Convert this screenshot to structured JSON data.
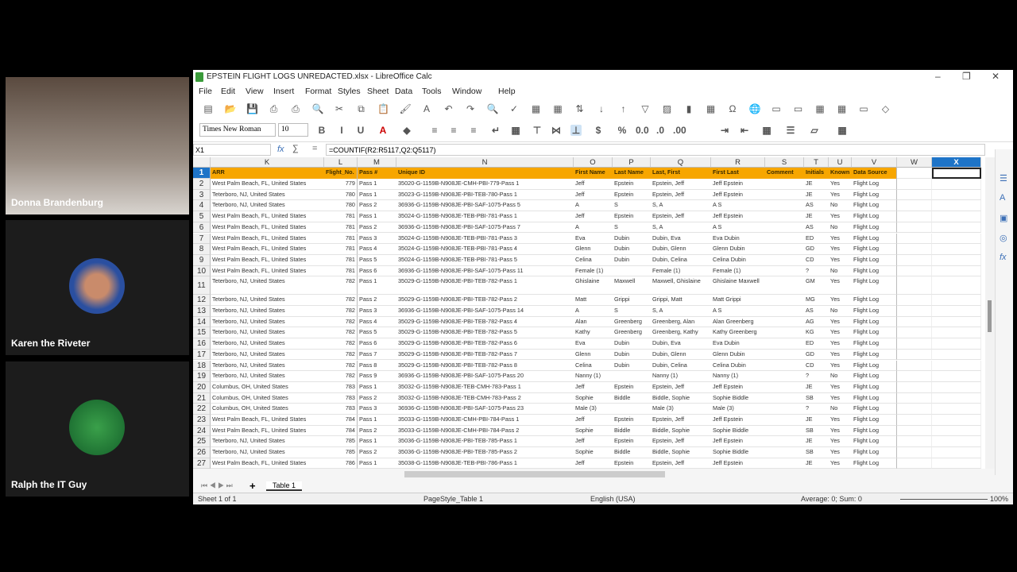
{
  "participants": [
    {
      "name": "Donna Brandenburg",
      "video": true
    },
    {
      "name": "Karen the Riveter",
      "video": false
    },
    {
      "name": "Ralph the IT Guy",
      "video": false
    }
  ],
  "window": {
    "title": "EPSTEIN FLIGHT LOGS UNREDACTED.xlsx - LibreOffice Calc"
  },
  "menu": [
    "File",
    "Edit",
    "View",
    "Insert",
    "Format",
    "Styles",
    "Sheet",
    "Data",
    "Tools",
    "Window",
    "Help"
  ],
  "format": {
    "font": "Times New Roman",
    "size": "10"
  },
  "formula_bar": {
    "cell_ref": "X1",
    "formula": "=COUNTIF(R2:R5117,Q2:Q5117)"
  },
  "sheet": {
    "columns": [
      "K",
      "L",
      "M",
      "N",
      "O",
      "P",
      "Q",
      "R",
      "S",
      "T",
      "U",
      "V",
      "W",
      "X"
    ],
    "selected_column": "X",
    "header": [
      "ARR",
      "Flight_No.",
      "Pass #",
      "Unique ID",
      "First Name",
      "Last Name",
      "Last, First",
      "First Last",
      "Comment",
      "Initials",
      "Known",
      "Data Source"
    ],
    "rows": [
      [
        "West Palm Beach, FL, United States",
        "779",
        "Pass 1",
        "35020-G-1159B-N908JE-CMH-PBI-779-Pass 1",
        "Jeff",
        "Epstein",
        "Epstein, Jeff",
        "Jeff Epstein",
        "",
        "JE",
        "Yes",
        "Flight Log"
      ],
      [
        "Teterboro, NJ, United States",
        "780",
        "Pass 1",
        "35023-G-1159B-N908JE-PBI-TEB-780-Pass 1",
        "Jeff",
        "Epstein",
        "Epstein, Jeff",
        "Jeff Epstein",
        "",
        "JE",
        "Yes",
        "Flight Log"
      ],
      [
        "Teterboro, NJ, United States",
        "780",
        "Pass 2",
        "36936-G-1159B-N908JE-PBI-SAF-1075-Pass 5",
        "A",
        "S",
        "S, A",
        "A S",
        "",
        "AS",
        "No",
        "Flight Log"
      ],
      [
        "West Palm Beach, FL, United States",
        "781",
        "Pass 1",
        "35024-G-1159B-N908JE-TEB-PBI-781-Pass 1",
        "Jeff",
        "Epstein",
        "Epstein, Jeff",
        "Jeff Epstein",
        "",
        "JE",
        "Yes",
        "Flight Log"
      ],
      [
        "West Palm Beach, FL, United States",
        "781",
        "Pass 2",
        "36936-G-1159B-N908JE-PBI-SAF-1075-Pass 7",
        "A",
        "S",
        "S, A",
        "A S",
        "",
        "AS",
        "No",
        "Flight Log"
      ],
      [
        "West Palm Beach, FL, United States",
        "781",
        "Pass 3",
        "35024-G-1159B-N908JE-TEB-PBI-781-Pass 3",
        "Eva",
        "Dubin",
        "Dubin, Eva",
        "Eva Dubin",
        "",
        "ED",
        "Yes",
        "Flight Log"
      ],
      [
        "West Palm Beach, FL, United States",
        "781",
        "Pass 4",
        "35024-G-1159B-N908JE-TEB-PBI-781-Pass 4",
        "Glenn",
        "Dubin",
        "Dubin, Glenn",
        "Glenn Dubin",
        "",
        "GD",
        "Yes",
        "Flight Log"
      ],
      [
        "West Palm Beach, FL, United States",
        "781",
        "Pass 5",
        "35024-G-1159B-N908JE-TEB-PBI-781-Pass 5",
        "Celina",
        "Dubin",
        "Dubin, Celina",
        "Celina Dubin",
        "",
        "CD",
        "Yes",
        "Flight Log"
      ],
      [
        "West Palm Beach, FL, United States",
        "781",
        "Pass 6",
        "36936-G-1159B-N908JE-PBI-SAF-1075-Pass 11",
        "Female (1)",
        "",
        "Female (1)",
        "Female (1)",
        "",
        "?",
        "No",
        "Flight Log"
      ],
      [
        "Teterboro, NJ, United States",
        "782",
        "Pass 1",
        "35029-G-1159B-N908JE-PBI-TEB-782-Pass 1",
        "Ghislaine",
        "Maxwell",
        "Maxwell, Ghislaine",
        "Ghislaine Maxwell",
        "",
        "GM",
        "Yes",
        "Flight Log"
      ],
      [
        "Teterboro, NJ, United States",
        "782",
        "Pass 2",
        "35029-G-1159B-N908JE-PBI-TEB-782-Pass 2",
        "Matt",
        "Grippi",
        "Grippi, Matt",
        "Matt Grippi",
        "",
        "MG",
        "Yes",
        "Flight Log"
      ],
      [
        "Teterboro, NJ, United States",
        "782",
        "Pass 3",
        "36936-G-1159B-N908JE-PBI-SAF-1075-Pass 14",
        "A",
        "S",
        "S, A",
        "A S",
        "",
        "AS",
        "No",
        "Flight Log"
      ],
      [
        "Teterboro, NJ, United States",
        "782",
        "Pass 4",
        "35029-G-1159B-N908JE-PBI-TEB-782-Pass 4",
        "Alan",
        "Greenberg",
        "Greenberg, Alan",
        "Alan Greenberg",
        "",
        "AG",
        "Yes",
        "Flight Log"
      ],
      [
        "Teterboro, NJ, United States",
        "782",
        "Pass 5",
        "35029-G-1159B-N908JE-PBI-TEB-782-Pass 5",
        "Kathy",
        "Greenberg",
        "Greenberg, Kathy",
        "Kathy Greenberg",
        "",
        "KG",
        "Yes",
        "Flight Log"
      ],
      [
        "Teterboro, NJ, United States",
        "782",
        "Pass 6",
        "35029-G-1159B-N908JE-PBI-TEB-782-Pass 6",
        "Eva",
        "Dubin",
        "Dubin, Eva",
        "Eva Dubin",
        "",
        "ED",
        "Yes",
        "Flight Log"
      ],
      [
        "Teterboro, NJ, United States",
        "782",
        "Pass 7",
        "35029-G-1159B-N908JE-PBI-TEB-782-Pass 7",
        "Glenn",
        "Dubin",
        "Dubin, Glenn",
        "Glenn Dubin",
        "",
        "GD",
        "Yes",
        "Flight Log"
      ],
      [
        "Teterboro, NJ, United States",
        "782",
        "Pass 8",
        "35029-G-1159B-N908JE-PBI-TEB-782-Pass 8",
        "Celina",
        "Dubin",
        "Dubin, Celina",
        "Celina Dubin",
        "",
        "CD",
        "Yes",
        "Flight Log"
      ],
      [
        "Teterboro, NJ, United States",
        "782",
        "Pass 9",
        "36936-G-1159B-N908JE-PBI-SAF-1075-Pass 20",
        "Nanny (1)",
        "",
        "Nanny (1)",
        "Nanny (1)",
        "",
        "?",
        "No",
        "Flight Log"
      ],
      [
        "Columbus, OH, United States",
        "783",
        "Pass 1",
        "35032-G-1159B-N908JE-TEB-CMH-783-Pass 1",
        "Jeff",
        "Epstein",
        "Epstein, Jeff",
        "Jeff Epstein",
        "",
        "JE",
        "Yes",
        "Flight Log"
      ],
      [
        "Columbus, OH, United States",
        "783",
        "Pass 2",
        "35032-G-1159B-N908JE-TEB-CMH-783-Pass 2",
        "Sophie",
        "Biddle",
        "Biddle, Sophie",
        "Sophie Biddle",
        "",
        "SB",
        "Yes",
        "Flight Log"
      ],
      [
        "Columbus, OH, United States",
        "783",
        "Pass 3",
        "36936-G-1159B-N908JE-PBI-SAF-1075-Pass 23",
        "Male (3)",
        "",
        "Male (3)",
        "Male (3)",
        "",
        "?",
        "No",
        "Flight Log"
      ],
      [
        "West Palm Beach, FL, United States",
        "784",
        "Pass 1",
        "35033-G-1159B-N908JE-CMH-PBI-784-Pass 1",
        "Jeff",
        "Epstein",
        "Epstein, Jeff",
        "Jeff Epstein",
        "",
        "JE",
        "Yes",
        "Flight Log"
      ],
      [
        "West Palm Beach, FL, United States",
        "784",
        "Pass 2",
        "35033-G-1159B-N908JE-CMH-PBI-784-Pass 2",
        "Sophie",
        "Biddle",
        "Biddle, Sophie",
        "Sophie Biddle",
        "",
        "SB",
        "Yes",
        "Flight Log"
      ],
      [
        "Teterboro, NJ, United States",
        "785",
        "Pass 1",
        "35036-G-1159B-N908JE-PBI-TEB-785-Pass 1",
        "Jeff",
        "Epstein",
        "Epstein, Jeff",
        "Jeff Epstein",
        "",
        "JE",
        "Yes",
        "Flight Log"
      ],
      [
        "Teterboro, NJ, United States",
        "785",
        "Pass 2",
        "35036-G-1159B-N908JE-PBI-TEB-785-Pass 2",
        "Sophie",
        "Biddle",
        "Biddle, Sophie",
        "Sophie Biddle",
        "",
        "SB",
        "Yes",
        "Flight Log"
      ],
      [
        "West Palm Beach, FL, United States",
        "786",
        "Pass 1",
        "35038-G-1159B-N908JE-TEB-PBI-786-Pass 1",
        "Jeff",
        "Epstein",
        "Epstein, Jeff",
        "Jeff Epstein",
        "",
        "JE",
        "Yes",
        "Flight Log"
      ]
    ]
  },
  "sheet_tabs": [
    "Table 1"
  ],
  "status": {
    "sheet": "Sheet 1 of 1",
    "page_style": "PageStyle_Table 1",
    "language": "English (USA)",
    "summary": "Average: 0; Sum: 0",
    "zoom": "100%"
  },
  "colors": {
    "header_fill": "#f7a600",
    "selection": "#1e74c8"
  }
}
